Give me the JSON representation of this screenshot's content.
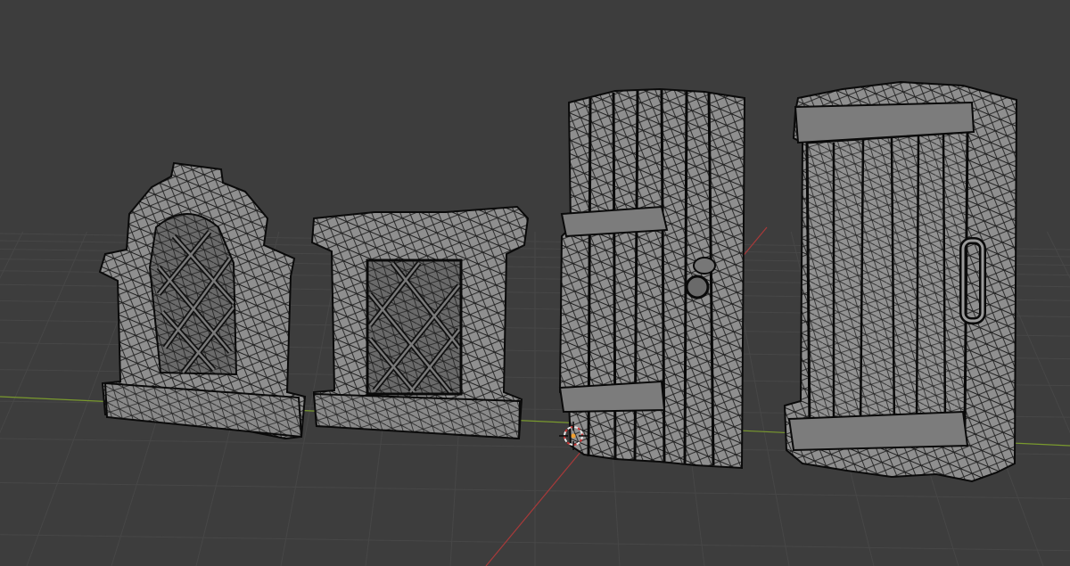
{
  "viewport": {
    "background": "#3d3d3d",
    "grid_color": "#474747",
    "x_axis_color": "#7a9a2e",
    "y_axis_color": "#a83a3a",
    "mesh_fill": "#8f8f8f",
    "wire_color": "#0a0a0a",
    "origin_cursor_color": "#e8e8e8",
    "origin_cursor_accent": "#c83232"
  },
  "objects": [
    {
      "name": "arched-lattice-window"
    },
    {
      "name": "square-lattice-window"
    },
    {
      "name": "plank-door-with-ring-handle"
    },
    {
      "name": "framed-plank-door-with-handle"
    }
  ]
}
